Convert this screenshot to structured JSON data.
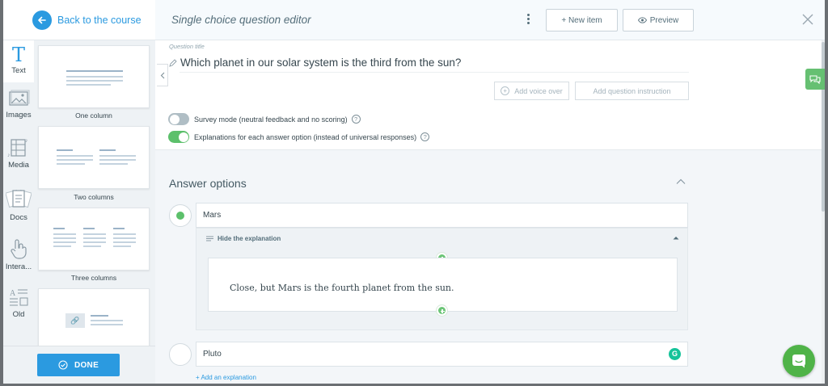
{
  "sidebar": {
    "back_label": "Back to the course",
    "tabs": [
      {
        "label": "Text",
        "icon": "text-icon",
        "active": true
      },
      {
        "label": "Images",
        "icon": "image-icon"
      },
      {
        "label": "Media",
        "icon": "media-icon"
      },
      {
        "label": "Docs",
        "icon": "docs-icon"
      },
      {
        "label": "Intera...",
        "icon": "interactive-icon"
      },
      {
        "label": "Old",
        "icon": "old-blocks-icon"
      }
    ],
    "layouts": [
      {
        "label": "One column"
      },
      {
        "label": "Two columns"
      },
      {
        "label": "Three columns"
      },
      {
        "label": ""
      }
    ],
    "done_label": "DONE"
  },
  "header": {
    "title": "Single choice question editor",
    "new_item_label": "+ New item",
    "preview_label": "Preview"
  },
  "question": {
    "caption": "Question title",
    "text": "Which planet in our solar system is the third from the sun?",
    "add_voice_over_label": "Add voice over",
    "add_instruction_label": "Add question instruction",
    "survey_mode_label": "Survey mode (neutral feedback and no scoring)",
    "survey_mode_on": false,
    "explanations_label": "Explanations for each answer option (instead of universal responses)",
    "explanations_on": true
  },
  "answers": {
    "title": "Answer options",
    "options": [
      {
        "text": "Mars",
        "selected": true
      },
      {
        "text": "Pluto",
        "selected": false
      }
    ],
    "hide_explanation_label": "Hide the explanation",
    "explanation_text": "Close, but Mars is the fourth planet from the sun.",
    "add_explanation_label": "+ Add an explanation"
  },
  "colors": {
    "accent": "#2b9ae0",
    "success": "#5cc06b",
    "grammarly": "#15c39a"
  }
}
